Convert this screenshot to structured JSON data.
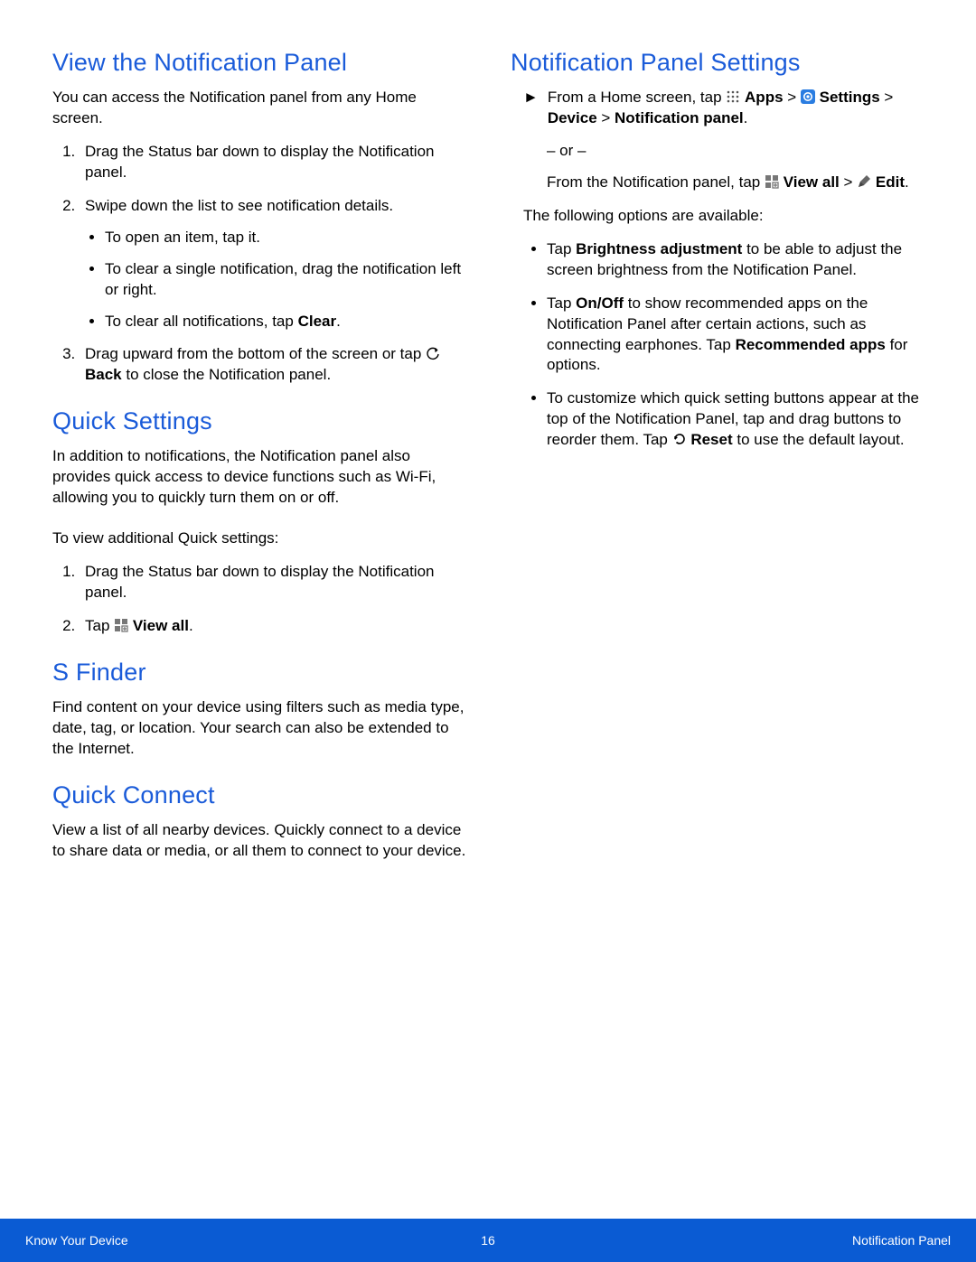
{
  "left": {
    "h_view": "View the Notification Panel",
    "p_view_intro": "You can access the Notification panel from any Home screen.",
    "ol1_1": "Drag the Status bar down to display the Notification panel.",
    "ol1_2": "Swipe down the list to see notification details.",
    "ol1_2_b1": "To open an item, tap it.",
    "ol1_2_b2": "To clear a single notification, drag the notification left or right.",
    "ol1_2_b3a": "To clear all notifications, tap ",
    "ol1_2_b3b": "Clear",
    "ol1_2_b3c": ".",
    "ol1_3a": "Drag upward from the bottom of the screen or tap ",
    "ol1_3b": "Back",
    "ol1_3c": " to close the Notification panel.",
    "h_qs": "Quick Settings",
    "p_qs_intro": "In addition to notifications, the Notification panel also provides quick access to device functions such as Wi-Fi, allowing you to quickly turn them on or off.",
    "p_qs_lead": "To view additional Quick settings:",
    "ol2_1": "Drag the Status bar down to display the Notification panel.",
    "ol2_2a": "Tap ",
    "ol2_2b": "View all",
    "ol2_2c": ".",
    "h_sf": "S Finder",
    "p_sf": "Find content on your device using filters such as media type, date, tag, or location. Your search can also be extended to the Internet.",
    "h_qc": "Quick Connect",
    "p_qc": "View a list of all nearby devices. Quickly connect to a device to share data or media, or all them to connect to your device."
  },
  "right": {
    "h_nps": "Notification Panel Settings",
    "arrow_marker": "►",
    "step1a": "From a Home screen, tap ",
    "step1b": "Apps",
    "step1c": " > ",
    "step1d": "Settings",
    "step1e": " > ",
    "step1f": "Device",
    "step1g": " > ",
    "step1h": "Notification panel",
    "step1i": ".",
    "or": "– or –",
    "step2a": "From the Notification panel, tap ",
    "step2b": "View all",
    "step2c": " > ",
    "step2d": "Edit",
    "step2e": ".",
    "avail": "The following options are available:",
    "b1a": "Tap ",
    "b1b": "Brightness adjustment",
    "b1c": " to be able to adjust the screen brightness from the Notification Panel.",
    "b2a": "Tap ",
    "b2b": "On/Off",
    "b2c": " to show recommended apps on the Notification Panel after certain actions, such as connecting earphones. Tap ",
    "b2d": "Recommended apps",
    "b2e": " for options.",
    "b3a": "To customize which quick setting buttons appear at the top of the Notification Panel, tap and drag buttons to reorder them. Tap ",
    "b3b": "Reset",
    "b3c": " to use the default layout."
  },
  "footer": {
    "left": "Know Your Device",
    "center": "16",
    "right": "Notification Panel"
  }
}
